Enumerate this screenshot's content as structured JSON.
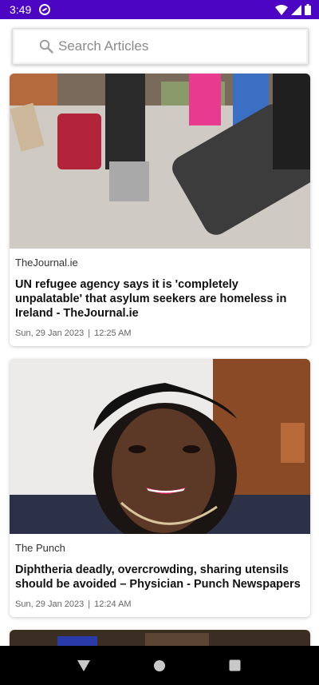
{
  "status_bar": {
    "time": "3:49",
    "icons": [
      "notification-icon",
      "wifi-icon",
      "signal-icon",
      "battery-icon"
    ]
  },
  "search": {
    "placeholder": "Search Articles",
    "value": ""
  },
  "articles": [
    {
      "source": "TheJournal.ie",
      "title": "UN refugee agency says it is 'completely unpalatable' that asylum seekers are homeless in Ireland - TheJournal.ie",
      "date": "Sun, 29 Jan 2023",
      "time": "12:25 AM"
    },
    {
      "source": "The Punch",
      "title": "Diphtheria deadly, overcrowding, sharing utensils should be avoided – Physician - Punch Newspapers",
      "date": "Sun, 29 Jan 2023",
      "time": "12:24 AM"
    }
  ],
  "meta_separator": "|",
  "nav_bar": {
    "icons": [
      "back-icon",
      "home-icon",
      "recents-icon"
    ]
  },
  "colors": {
    "status_bar": "#4b05c3",
    "nav_bar": "#000000",
    "background": "#ffffff"
  }
}
